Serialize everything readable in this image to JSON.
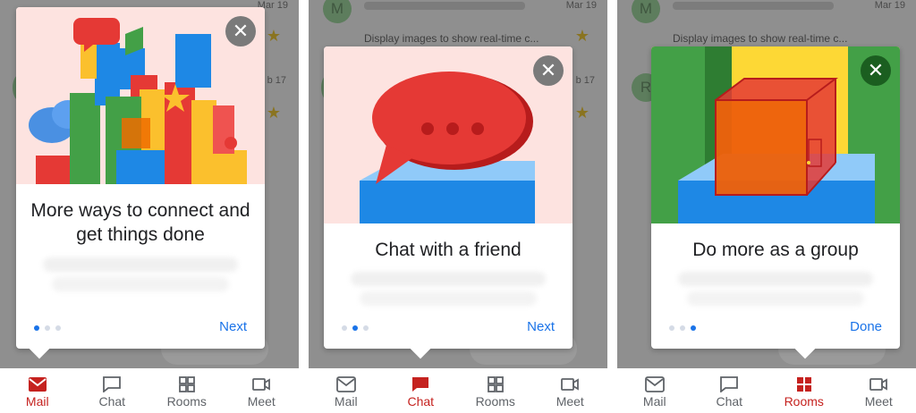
{
  "background": {
    "date_top": "Mar 19",
    "date_second": "b 17",
    "date_second_alt": "b 17",
    "snippet": "Display images to show real-time c...",
    "avatar_m": "M",
    "avatar_r": "R"
  },
  "screens": [
    {
      "title": "More ways to connect and get things done",
      "action": "Next",
      "active_dot": 0
    },
    {
      "title": "Chat with a friend",
      "action": "Next",
      "active_dot": 1
    },
    {
      "title": "Do more as a group",
      "action": "Done",
      "active_dot": 2
    }
  ],
  "nav": {
    "mail": "Mail",
    "chat": "Chat",
    "rooms": "Rooms",
    "meet": "Meet"
  },
  "colors": {
    "accent": "#1a73e8",
    "active_nav": "#c5221f",
    "card_art_bg": "#fde3e0"
  },
  "icons": [
    "close-icon",
    "mail-icon",
    "chat-icon",
    "rooms-icon",
    "meet-icon",
    "star-icon"
  ]
}
